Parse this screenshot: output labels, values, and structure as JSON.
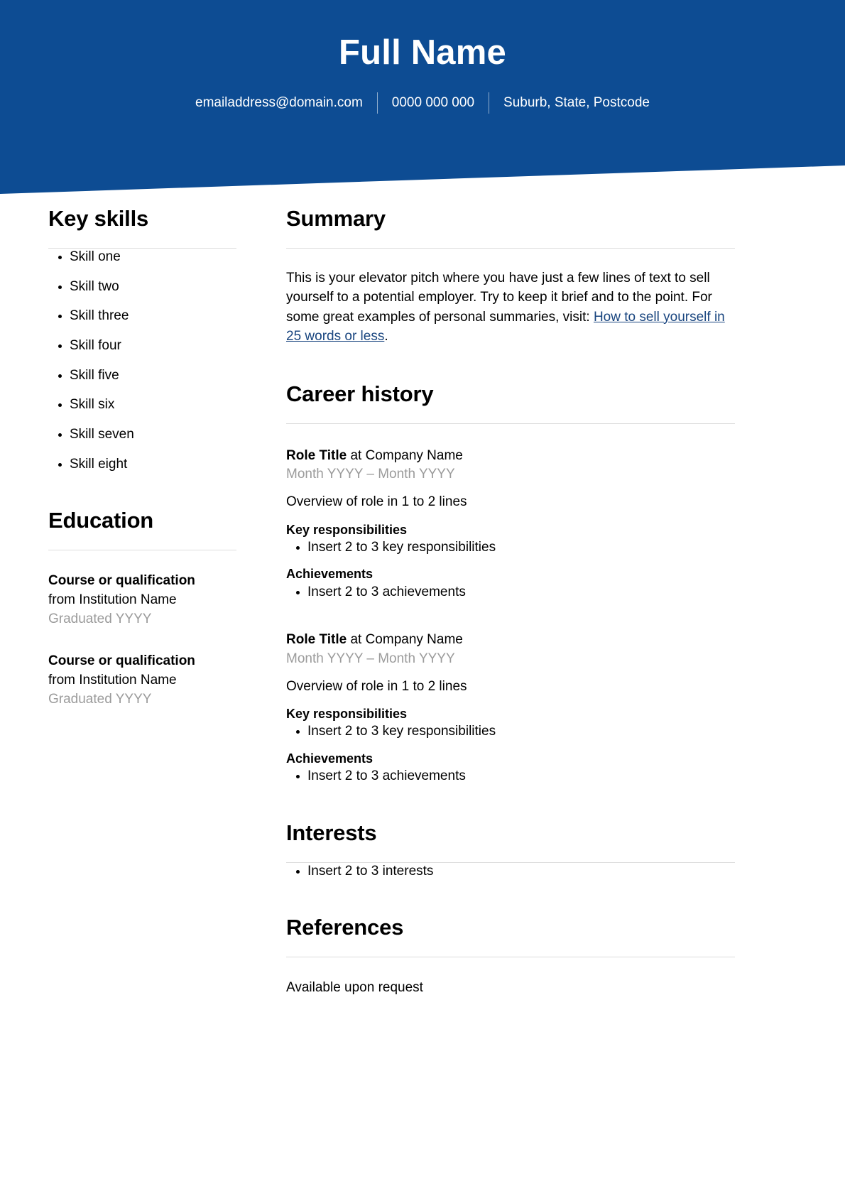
{
  "theme": {
    "header_blue": "#0d4c93",
    "link_blue": "#19457f",
    "muted_gray": "#9b9b9b",
    "rule_gray": "#dcdcdc"
  },
  "header": {
    "full_name": "Full Name",
    "contact": {
      "email": "emailaddress@domain.com",
      "phone": "0000 000 000",
      "location": "Suburb, State, Postcode"
    }
  },
  "sidebar": {
    "key_skills": {
      "heading": "Key skills",
      "items": [
        "Skill one",
        "Skill two",
        "Skill three",
        "Skill four",
        "Skill five",
        "Skill six",
        "Skill seven",
        "Skill eight"
      ]
    },
    "education": {
      "heading": "Education",
      "entries": [
        {
          "course": "Course or qualification",
          "institution": "from Institution Name",
          "graduated": "Graduated YYYY"
        },
        {
          "course": "Course or qualification",
          "institution": "from Institution Name",
          "graduated": "Graduated YYYY"
        }
      ]
    }
  },
  "main": {
    "summary": {
      "heading": "Summary",
      "body_before_link": "This is your elevator pitch where you have just a few lines of text to sell yourself to a potential employer. Try to keep it brief and to the point. For some great examples of personal summaries, visit: ",
      "link_text": "How to sell yourself in 25 words or less",
      "body_after_link": "."
    },
    "career_history": {
      "heading": "Career history",
      "jobs": [
        {
          "role": "Role Title",
          "connector": " at ",
          "company": "Company Name",
          "dates": "Month YYYY – Month YYYY",
          "overview": "Overview of role in 1 to 2 lines",
          "responsibilities_heading": "Key responsibilities",
          "responsibilities": [
            "Insert 2 to 3 key responsibilities"
          ],
          "achievements_heading": "Achievements",
          "achievements": [
            "Insert 2 to 3 achievements"
          ]
        },
        {
          "role": "Role Title",
          "connector": " at ",
          "company": "Company Name",
          "dates": "Month YYYY – Month YYYY",
          "overview": "Overview of role in 1 to 2 lines",
          "responsibilities_heading": "Key responsibilities",
          "responsibilities": [
            "Insert 2 to 3 key responsibilities"
          ],
          "achievements_heading": "Achievements",
          "achievements": [
            "Insert 2 to 3 achievements"
          ]
        }
      ]
    },
    "interests": {
      "heading": "Interests",
      "items": [
        "Insert 2 to 3 interests"
      ]
    },
    "references": {
      "heading": "References",
      "body": "Available upon request"
    }
  }
}
